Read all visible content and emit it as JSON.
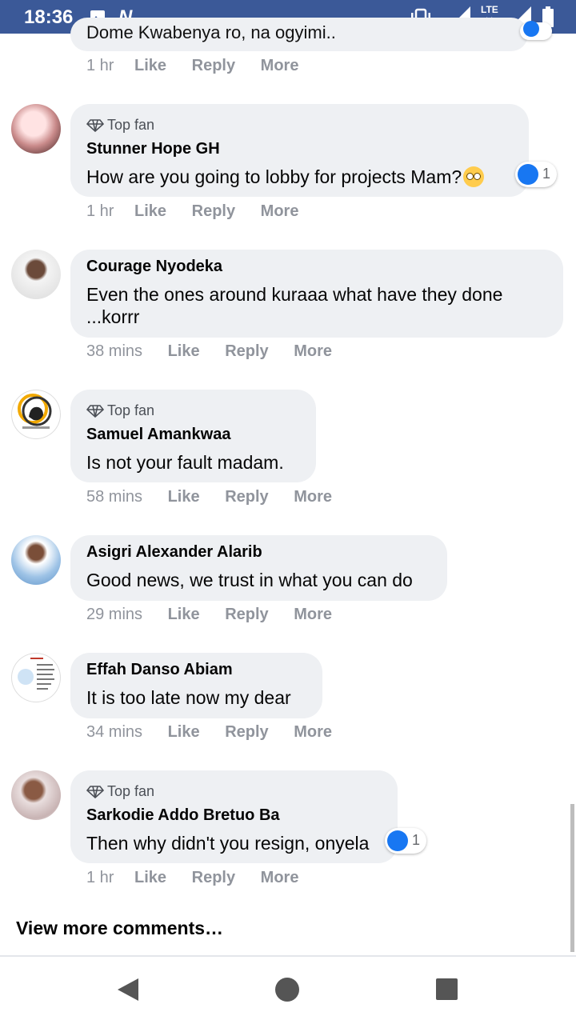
{
  "status_bar": {
    "time": "18:36",
    "network": "LTE",
    "notification_icon": "N"
  },
  "top_partial": {
    "text": "Dome Kwabenya ro, na ogyimi..",
    "meta": {
      "time": "1 hr",
      "like": "Like",
      "reply": "Reply",
      "more": "More"
    }
  },
  "comments": [
    {
      "name": "Stunner Hope GH",
      "top_fan": "Top fan",
      "text": "How are you going to lobby for projects Mam?",
      "reactions": "1",
      "meta": {
        "time": "1 hr",
        "like": "Like",
        "reply": "Reply",
        "more": "More"
      }
    },
    {
      "name": "Courage Nyodeka",
      "text": "Even the ones around kuraaa what have they done ...korrr",
      "meta": {
        "time": "38 mins",
        "like": "Like",
        "reply": "Reply",
        "more": "More"
      }
    },
    {
      "name": "Samuel Amankwaa",
      "top_fan": "Top fan",
      "text": "Is not your fault madam.",
      "meta": {
        "time": "58 mins",
        "like": "Like",
        "reply": "Reply",
        "more": "More"
      }
    },
    {
      "name": "Asigri Alexander Alarib",
      "text": "Good news, we trust in what you can do",
      "meta": {
        "time": "29 mins",
        "like": "Like",
        "reply": "Reply",
        "more": "More"
      }
    },
    {
      "name": "Effah Danso Abiam",
      "text": "It is too late now my dear",
      "meta": {
        "time": "34 mins",
        "like": "Like",
        "reply": "Reply",
        "more": "More"
      }
    },
    {
      "name": "Sarkodie Addo Bretuo Ba",
      "top_fan": "Top fan",
      "text": "Then why didn't you resign, onyela",
      "reactions": "1",
      "meta": {
        "time": "1 hr",
        "like": "Like",
        "reply": "Reply",
        "more": "More"
      }
    }
  ],
  "view_more": "View more comments…",
  "colors": {
    "status_bar": "#3b5998",
    "bubble": "#eef0f3",
    "like_blue": "#1877f2",
    "meta_gray": "#90949c"
  }
}
